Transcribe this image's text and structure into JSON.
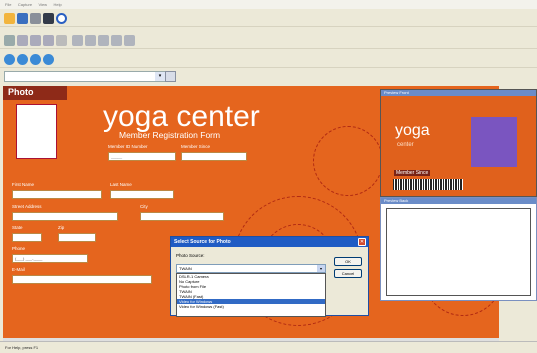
{
  "menu": [
    "File",
    "Capture",
    "View",
    "Help"
  ],
  "combo": {
    "value": "",
    "arrow": "▾"
  },
  "card": {
    "photo_label": "Photo",
    "title": "yoga center",
    "subtitle": "Member Registration Form",
    "member_id_label": "Member ID Number",
    "member_id_value": "_____",
    "member_since_label": "Member Since",
    "first_name_label": "First Name",
    "last_name_label": "Last Name",
    "street_label": "Street Address",
    "city_label": "City",
    "state_label": "State",
    "zip_label": "Zip",
    "phone_label": "Phone",
    "phone_value": "(___) ___-____",
    "email_label": "E-Mail"
  },
  "preview_front": {
    "title": "Preview Front",
    "logo": "yoga",
    "logo_sub": "center",
    "member_since": "Member Since"
  },
  "preview_back": {
    "title": "Preview Back"
  },
  "dialog": {
    "title": "Select Source for Photo",
    "source_label": "Photo Source:",
    "selected": "TWAIN",
    "close": "✕",
    "options": [
      "DSLR-1 Camera",
      "No Capture",
      "Photo from File",
      "TWAIN",
      "TWAIN (Fast)",
      "Video for Windows",
      "Video for Windows (Fast)"
    ],
    "highlighted_index": 5,
    "ok_label": "OK",
    "cancel_label": "Cancel"
  },
  "status": "For Help, press F1",
  "colors": {
    "card_bg": "#e5651e",
    "accent_dark": "#8e2a18",
    "selection": "#316ac5"
  }
}
